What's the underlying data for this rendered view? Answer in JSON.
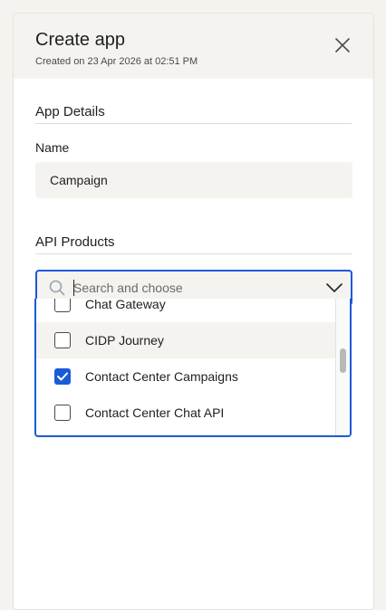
{
  "panel": {
    "title": "Create app",
    "subtitle": "Created on 23 Apr 2026 at 02:51 PM"
  },
  "app_details": {
    "section_title": "App Details",
    "name_label": "Name",
    "name_value": "Campaign"
  },
  "api_products": {
    "section_title": "API Products",
    "search_placeholder": "Search and choose",
    "options": [
      {
        "label": "Chat Gateway",
        "checked": false
      },
      {
        "label": "CIDP Journey",
        "checked": false
      },
      {
        "label": "Contact Center Campaigns",
        "checked": true
      },
      {
        "label": "Contact Center Chat API",
        "checked": false
      }
    ]
  },
  "colors": {
    "accent": "#1a5ad7",
    "surface": "#f4f3ef"
  },
  "icons": {
    "close": "close-icon",
    "search": "search-icon",
    "chevron": "chevron-down-icon",
    "check": "check-icon"
  }
}
